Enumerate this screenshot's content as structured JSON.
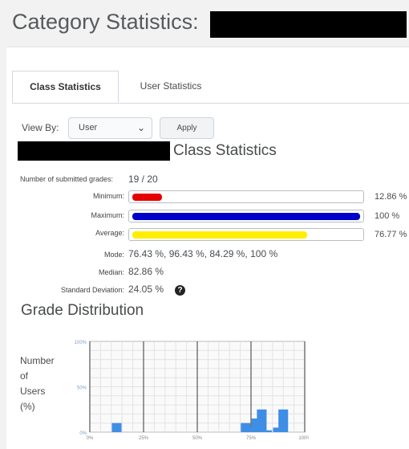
{
  "page": {
    "title": "Category Statistics:"
  },
  "tabs": [
    {
      "label": "Class Statistics",
      "active": true
    },
    {
      "label": "User Statistics",
      "active": false
    }
  ],
  "filter": {
    "view_by_label": "View By:",
    "selected": "User",
    "apply_label": "Apply"
  },
  "class_stats": {
    "heading": "Class Statistics",
    "submitted_label": "Number of submitted grades:",
    "submitted_value": "19 / 20",
    "minimum": {
      "label": "Minimum:",
      "value": "12.86 %",
      "fraction": 0.1286,
      "color": "#e60000"
    },
    "maximum": {
      "label": "Maximum:",
      "value": "100 %",
      "fraction": 1.0,
      "color": "#0000cc"
    },
    "average": {
      "label": "Average:",
      "value": "76.77 %",
      "fraction": 0.7677,
      "color": "#ffee00"
    },
    "mode_label": "Mode:",
    "mode_value": "76.43 %, 96.43 %, 84.29 %, 100 %",
    "median_label": "Median:",
    "median_value": "82.86 %",
    "std_label": "Standard Deviation:",
    "std_value": "24.05 %",
    "help_icon": "question-circle-icon"
  },
  "grade_distribution": {
    "heading": "Grade Distribution",
    "y_axis_label_lines": [
      "Number",
      "of",
      "Users",
      "(%)"
    ]
  },
  "chart_data": {
    "type": "bar",
    "ylabel": "Number of Users (%)",
    "ylim": [
      0,
      100
    ],
    "y_ticks": [
      "0%",
      "50%",
      "100%"
    ],
    "x_ticks": [
      "0%",
      "25%",
      "50%",
      "75%",
      "100%"
    ],
    "x": [
      12.5,
      72.5,
      75,
      77.5,
      80,
      82.5,
      87.5,
      90
    ],
    "values": [
      10,
      10,
      5,
      15,
      25,
      2,
      5,
      25
    ],
    "bar_color": "#3e8ee5",
    "grid": true
  }
}
